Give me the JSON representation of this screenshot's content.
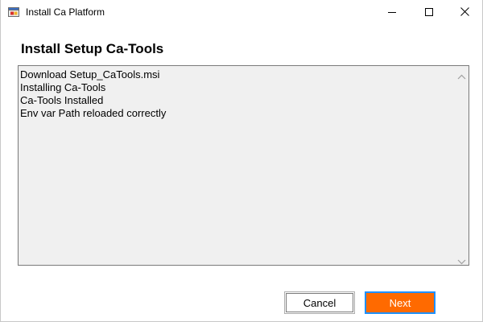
{
  "window": {
    "title": "Install Ca Platform"
  },
  "heading": "Install Setup Ca-Tools",
  "log": {
    "lines": [
      "Download Setup_CaTools.msi",
      "Installing Ca-Tools",
      "Ca-Tools Installed",
      "Env var Path reloaded correctly"
    ]
  },
  "buttons": {
    "cancel_label": "Cancel",
    "next_label": "Next"
  },
  "icons": {
    "app": "installer-icon",
    "minimize": "minimize-icon",
    "maximize": "maximize-icon",
    "close": "close-icon",
    "scroll_up": "chevron-up-icon",
    "scroll_down": "chevron-down-icon"
  },
  "colors": {
    "next_button_bg": "#ff6a00",
    "next_button_border": "#1e90ff",
    "log_bg": "#f0f0f0"
  }
}
